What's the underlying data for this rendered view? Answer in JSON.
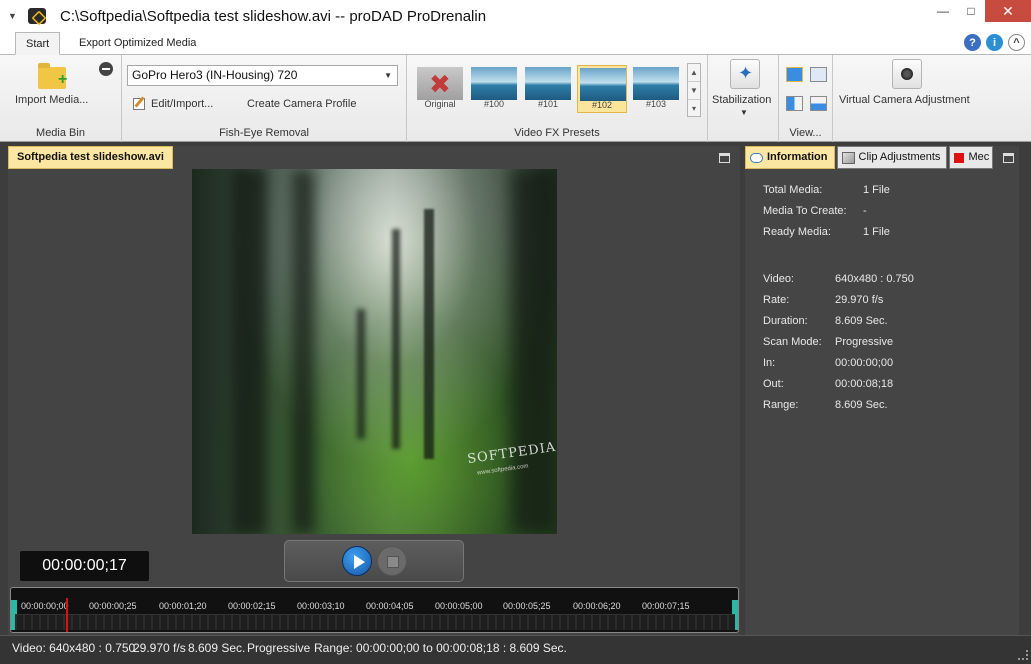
{
  "window": {
    "title": "C:\\Softpedia\\Softpedia test slideshow.avi -- proDAD ProDrenalin",
    "min_glyph": "—",
    "max_glyph": "□",
    "close_glyph": "✕"
  },
  "ribbon_tabs": [
    {
      "label": "Start",
      "active": true
    },
    {
      "label": "Export Optimized Media",
      "active": false
    }
  ],
  "help_icons": {
    "help": "?",
    "info": "i",
    "collapse": "^"
  },
  "media_bin": {
    "import_label": "Import Media...",
    "group_label": "Media Bin"
  },
  "fisheye": {
    "profile_value": "GoPro Hero3 (IN-Housing) 720",
    "edit_label": "Edit/Import...",
    "create_label": "Create Camera Profile",
    "group_label": "Fish-Eye Removal"
  },
  "video_fx": {
    "presets": [
      {
        "label": "Original",
        "selected": false
      },
      {
        "label": "#100",
        "selected": false
      },
      {
        "label": "#101",
        "selected": false
      },
      {
        "label": "#102",
        "selected": true
      },
      {
        "label": "#103",
        "selected": false
      }
    ],
    "group_label": "Video FX Presets"
  },
  "stabilization": {
    "label": "Stabilization"
  },
  "view": {
    "label": "View..."
  },
  "virtual_camera": {
    "label": "Virtual Camera Adjustment"
  },
  "document_tab": "Softpedia test slideshow.avi",
  "preview": {
    "watermark": "SOFTPEDIA®",
    "watermark_url": "www.softpedia.com"
  },
  "timecode": "00:00:00;17",
  "timeline": {
    "labels": [
      "00:00:00;00",
      "00:00:00;25",
      "00:00:01;20",
      "00:00:02;15",
      "00:00:03;10",
      "00:00:04;05",
      "00:00:05;00",
      "00:00:05;25",
      "00:00:06;20",
      "00:00:07;15"
    ]
  },
  "right_panel": {
    "tabs": [
      {
        "label": "Information",
        "active": true
      },
      {
        "label": "Clip Adjustments",
        "active": false
      },
      {
        "label": "Mec",
        "active": false
      }
    ],
    "summary": [
      {
        "key": "Total Media:",
        "value": "1 File"
      },
      {
        "key": "Media To Create:",
        "value": "-"
      },
      {
        "key": "Ready Media:",
        "value": "1 File"
      }
    ],
    "details": [
      {
        "key": "Video:",
        "value": "640x480 : 0.750"
      },
      {
        "key": "Rate:",
        "value": "29.970 f/s"
      },
      {
        "key": "Duration:",
        "value": "8.609 Sec."
      },
      {
        "key": "Scan Mode:",
        "value": "Progressive"
      },
      {
        "key": "In:",
        "value": "00:00:00;00"
      },
      {
        "key": "Out:",
        "value": "00:00:08;18"
      },
      {
        "key": "Range:",
        "value": "8.609 Sec."
      }
    ]
  },
  "status": {
    "video": "Video: 640x480 : 0.750",
    "rate": "29.970 f/s",
    "duration": "8.609 Sec.",
    "scan": "Progressive",
    "range": "Range: 00:00:00;00 to 00:00:08;18 : 8.609 Sec."
  }
}
